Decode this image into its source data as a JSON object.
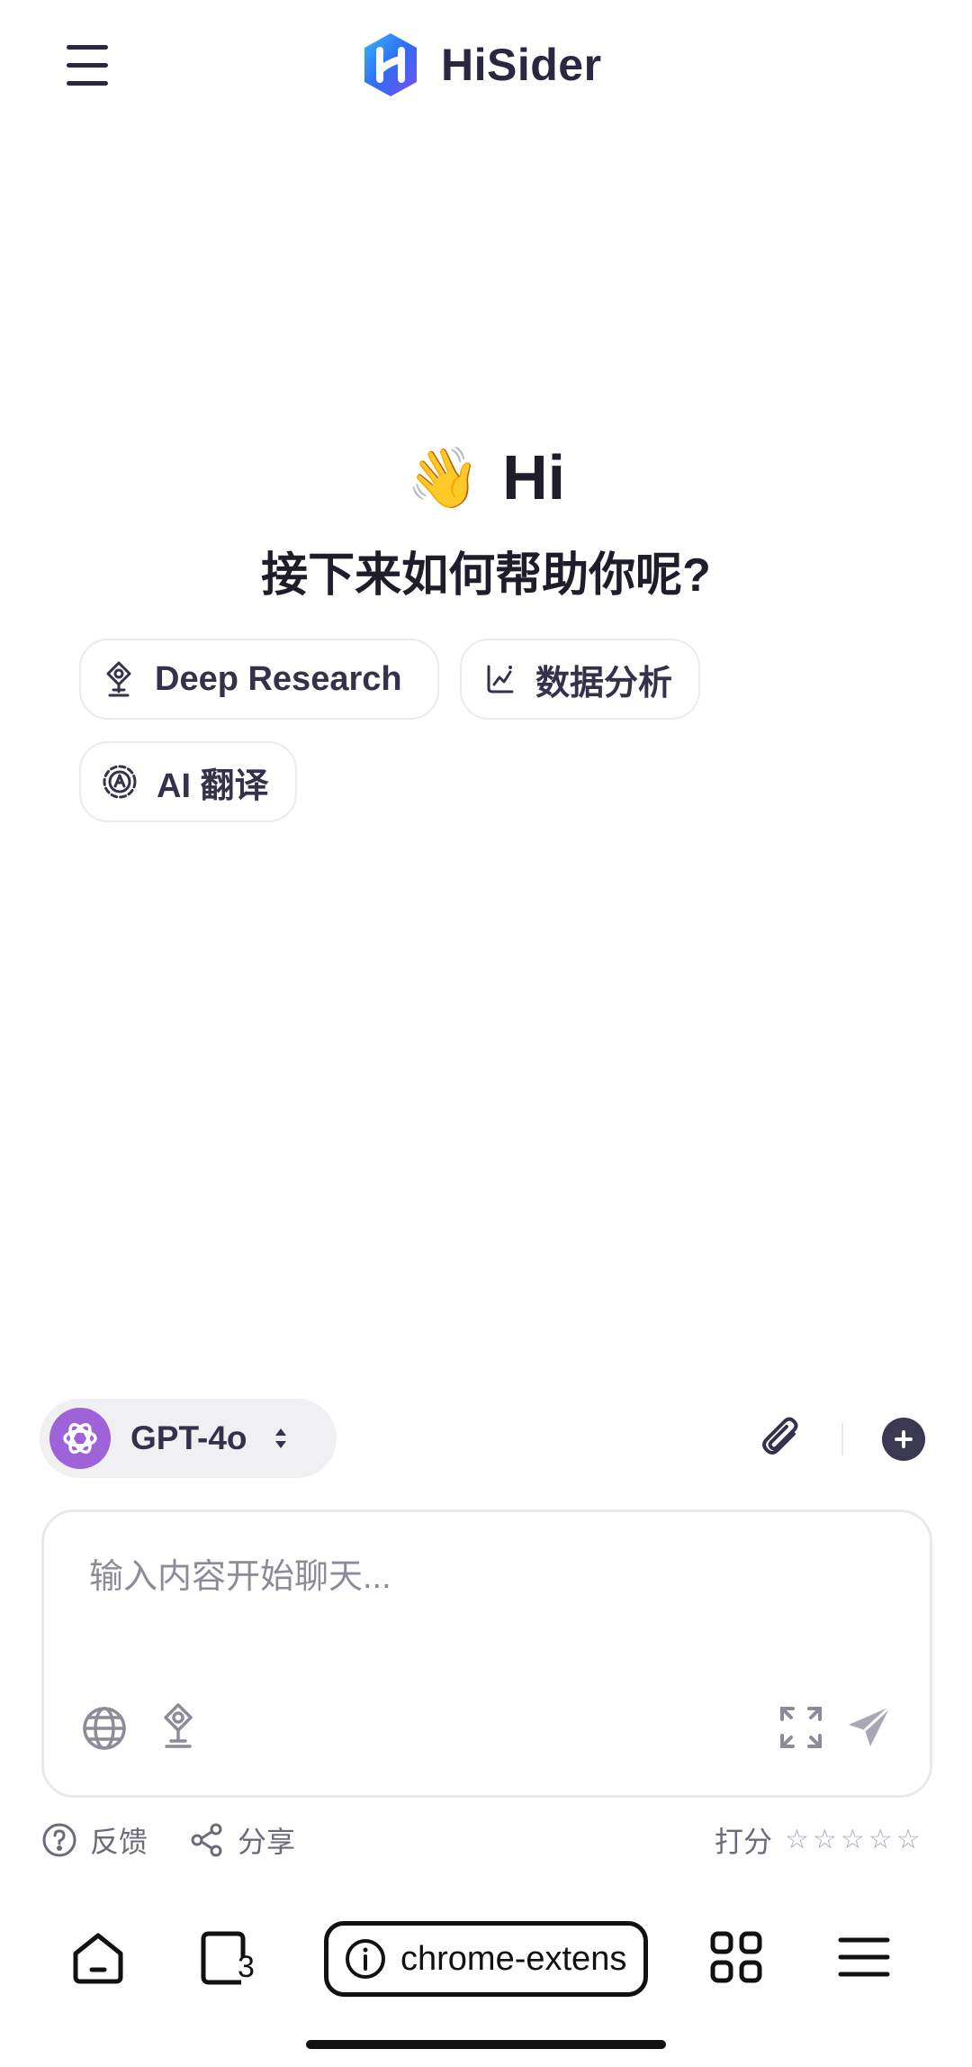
{
  "header": {
    "app_name": "HiSider"
  },
  "greeting": {
    "emoji": "👋",
    "hi": "Hi",
    "subtitle": "接下来如何帮助你呢?"
  },
  "chips": [
    {
      "label": "Deep Research",
      "icon": "deep-research-icon"
    },
    {
      "label": "数据分析",
      "icon": "data-analysis-icon"
    },
    {
      "label": "AI 翻译",
      "icon": "ai-translate-icon"
    }
  ],
  "model": {
    "name": "GPT-4o",
    "icon": "openai-icon"
  },
  "input": {
    "placeholder": "输入内容开始聊天..."
  },
  "footer": {
    "feedback": "反馈",
    "share": "分享",
    "rate_label": "打分",
    "stars": [
      "☆",
      "☆",
      "☆",
      "☆",
      "☆"
    ]
  },
  "browser": {
    "url": "chrome-extens",
    "tab_count": "3"
  },
  "colors": {
    "brand_blue": "#2f6df6",
    "brand_purple": "#7b4cf0",
    "model_purple": "#9e63d8",
    "text": "#2a2740"
  }
}
